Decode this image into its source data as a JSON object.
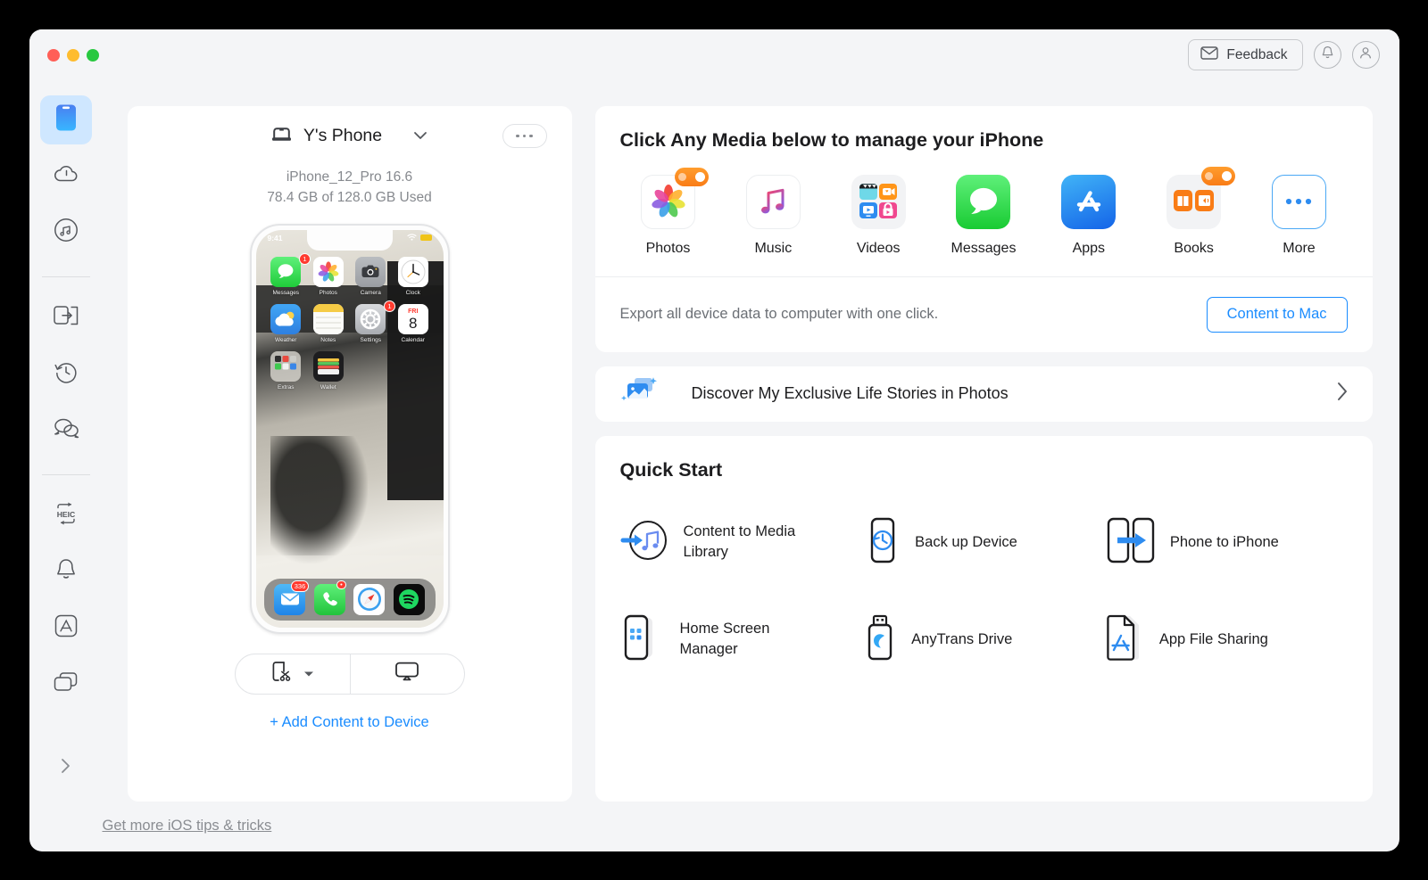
{
  "window": {
    "traffic_lights": [
      "close",
      "minimize",
      "zoom"
    ],
    "accent_blue": "#1a8cff",
    "sidebar_active_bg": "#cfe7ff"
  },
  "titlebar": {
    "feedback_label": "Feedback",
    "mail_icon": "mail-icon",
    "bell_icon": "bell-icon",
    "account_icon": "account-icon"
  },
  "sidebar": {
    "items": [
      {
        "name": "device",
        "icon": "device-icon",
        "active": true
      },
      {
        "name": "cloud",
        "icon": "cloud-icon",
        "active": false
      },
      {
        "name": "media-downloader",
        "icon": "music-circle-icon",
        "active": false
      },
      {
        "name": "device-manager",
        "icon": "transfer-icon",
        "active": false
      },
      {
        "name": "backup-history",
        "icon": "clock-history-icon",
        "active": false
      },
      {
        "name": "messages",
        "icon": "chat-bubbles-icon",
        "active": false
      },
      {
        "name": "heic-converter",
        "icon": "heic-icon",
        "active": false
      },
      {
        "name": "ringtone-maker",
        "icon": "bell-outline-icon",
        "active": false
      },
      {
        "name": "app-downloader",
        "icon": "appstore-icon",
        "active": false
      },
      {
        "name": "screen-mirror",
        "icon": "layers-icon",
        "active": false
      }
    ],
    "expand_icon": "chevron-right-icon"
  },
  "device": {
    "icon": "phone-device-icon",
    "name": "Y's Phone",
    "chevron_icon": "chevron-down-icon",
    "more_icon": "ellipsis-icon",
    "model": "iPhone_12_Pro 16.6",
    "storage": "78.4 GB of  128.0 GB Used",
    "segment_left_icon": "screenshot-cut-icon",
    "segment_left_chevron": "caret-down-icon",
    "segment_right_icon": "airplay-mirror-icon",
    "add_content_label": "+ Add Content to Device"
  },
  "phone_screen": {
    "time": "9:41",
    "wifi_icon": "wifi-icon",
    "battery_icon": "battery-icon",
    "apps": [
      {
        "label": "Messages",
        "icon": "messages-app-icon",
        "badge": "1"
      },
      {
        "label": "Photos",
        "icon": "photos-app-icon",
        "badge": ""
      },
      {
        "label": "Camera",
        "icon": "camera-app-icon",
        "badge": ""
      },
      {
        "label": "Clock",
        "icon": "clock-app-icon",
        "badge": ""
      },
      {
        "label": "Weather",
        "icon": "weather-app-icon",
        "badge": ""
      },
      {
        "label": "Notes",
        "icon": "notes-app-icon",
        "badge": ""
      },
      {
        "label": "Settings",
        "icon": "settings-app-icon",
        "badge": "1"
      },
      {
        "label": "Calendar",
        "icon": "calendar-app-icon",
        "badge": ""
      },
      {
        "label": "Extras",
        "icon": "folder-app-icon",
        "badge": ""
      },
      {
        "label": "Wallet",
        "icon": "wallet-app-icon",
        "badge": ""
      }
    ],
    "calendar_day": "8",
    "calendar_weekday": "FRI",
    "dock": [
      {
        "label": "Mail",
        "icon": "mail-app-icon",
        "badge": "336"
      },
      {
        "label": "Phone",
        "icon": "phone-app-icon",
        "badge": "•"
      },
      {
        "label": "Safari",
        "icon": "safari-app-icon",
        "badge": ""
      },
      {
        "label": "Spotify",
        "icon": "spotify-app-icon",
        "badge": ""
      }
    ]
  },
  "media": {
    "title": "Click Any Media below to manage your iPhone",
    "items": [
      {
        "label": "Photos",
        "icon": "photos-icon",
        "badge": true
      },
      {
        "label": "Music",
        "icon": "music-note-icon",
        "badge": false
      },
      {
        "label": "Videos",
        "icon": "videos-icon",
        "badge": false
      },
      {
        "label": "Messages",
        "icon": "messages-icon",
        "badge": false
      },
      {
        "label": "Apps",
        "icon": "appstore-blue-icon",
        "badge": false
      },
      {
        "label": "Books",
        "icon": "books-icon",
        "badge": true
      },
      {
        "label": "More",
        "icon": "more-dots-icon",
        "badge": false
      }
    ],
    "export_text": "Export all device data to computer with one click.",
    "export_button": "Content to Mac"
  },
  "discover": {
    "icon": "photo-sparkle-icon",
    "text": "Discover My Exclusive Life Stories in Photos",
    "chevron_icon": "chevron-right-icon"
  },
  "quick_start": {
    "title": "Quick Start",
    "items": [
      {
        "label": "Content to Media Library",
        "icon": "content-to-media-library-icon"
      },
      {
        "label": "Back up Device",
        "icon": "backup-device-icon"
      },
      {
        "label": "Phone to iPhone",
        "icon": "phone-to-iphone-icon"
      },
      {
        "label": "Home Screen Manager",
        "icon": "home-screen-manager-icon"
      },
      {
        "label": "AnyTrans Drive",
        "icon": "anytrans-drive-icon"
      },
      {
        "label": "App File Sharing",
        "icon": "app-file-sharing-icon"
      }
    ]
  },
  "footer": {
    "link": "Get more iOS tips & tricks"
  }
}
